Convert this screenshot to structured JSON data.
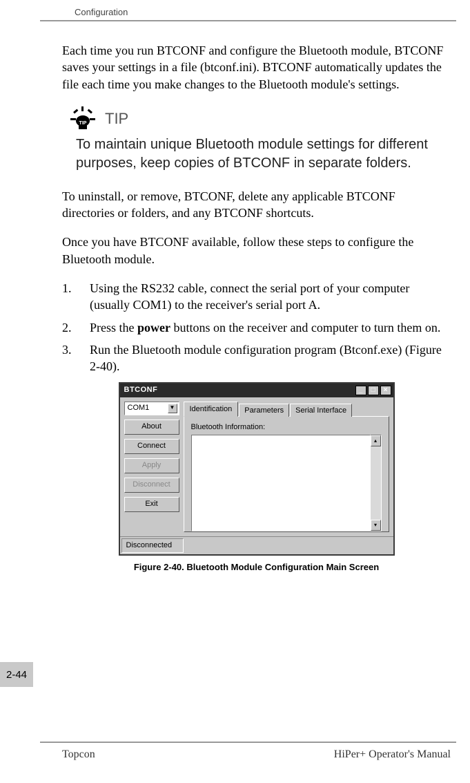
{
  "header": {
    "section": "Configuration"
  },
  "body": {
    "p1": "Each time you run BTCONF and configure the Bluetooth module, BTCONF saves your settings in a file (btconf.ini). BTCONF automatically updates the file each time you make changes to the Bluetooth module's settings.",
    "tip": {
      "label": "TIP",
      "text": "To maintain unique Bluetooth module settings for different purposes, keep copies of BTCONF in separate folders."
    },
    "p2": "To uninstall, or remove, BTCONF, delete any applicable BTCONF directories or folders, and any BTCONF shortcuts.",
    "p3": "Once you have BTCONF available, follow these steps to configure the Bluetooth module.",
    "steps": {
      "s1_num": "1.",
      "s1": "Using the RS232 cable, connect the serial port of your computer (usually COM1) to the receiver's serial port A.",
      "s2_num": "2.",
      "s2_a": "Press the ",
      "s2_bold": "power",
      "s2_b": " buttons on the receiver and computer to turn them on.",
      "s3_num": "3.",
      "s3": "Run the Bluetooth module configuration program (Btconf.exe) (Figure 2-40)."
    }
  },
  "app": {
    "title": "BTCONF",
    "combo_value": "COM1",
    "buttons": {
      "about": "About",
      "connect": "Connect",
      "apply": "Apply",
      "disconnect": "Disconnect",
      "exit": "Exit"
    },
    "tabs": {
      "identification": "Identification",
      "parameters": "Parameters",
      "serial": "Serial Interface"
    },
    "panel_label": "Bluetooth Information:",
    "status": "Disconnected"
  },
  "figure_caption": "Figure 2-40. Bluetooth Module Configuration Main Screen",
  "page_marker": "2-44",
  "footer": {
    "left": "Topcon",
    "right": "HiPer+ Operator's Manual"
  }
}
